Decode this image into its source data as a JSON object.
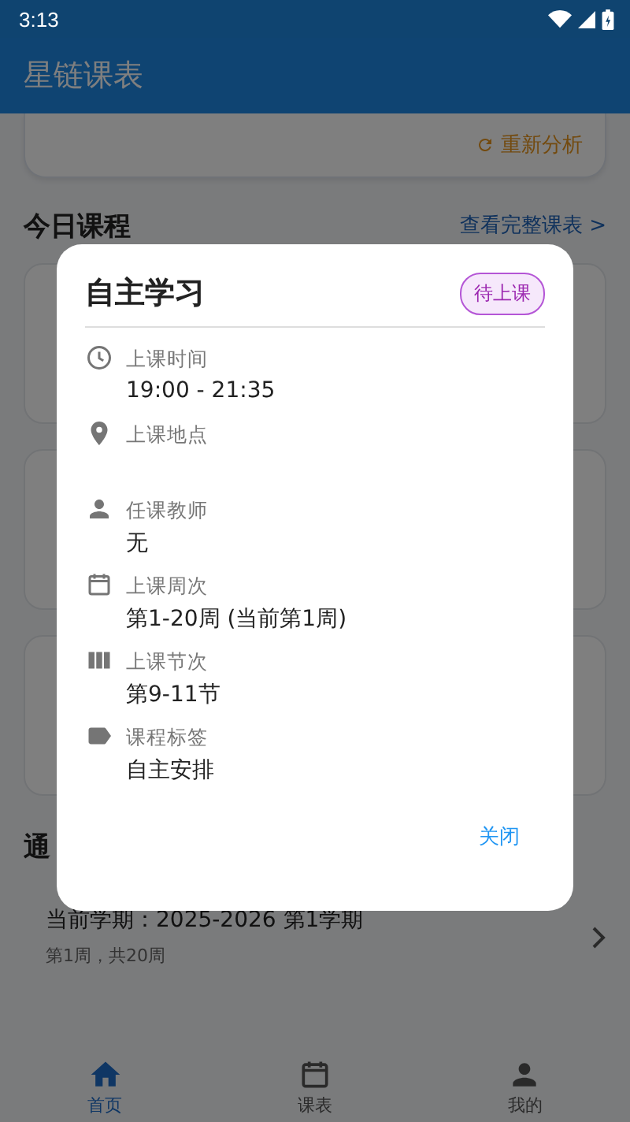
{
  "status_bar": {
    "time": "3:13"
  },
  "app_bar": {
    "title": "星链课表"
  },
  "analysis_card": {
    "action": "重新分析"
  },
  "today_section": {
    "title": "今日课程",
    "link": "查看完整课表 >"
  },
  "notice_section": {
    "title": "通"
  },
  "semester": {
    "title": "当前学期：2025-2026 第1学期",
    "subtitle": "第1周，共20周"
  },
  "nav": [
    {
      "label": "首页",
      "kind": "home",
      "selected": true
    },
    {
      "label": "课表",
      "kind": "calendar",
      "selected": false
    },
    {
      "label": "我的",
      "kind": "person",
      "selected": false
    }
  ],
  "dialog": {
    "title": "自主学习",
    "status": "待上课",
    "fields": [
      {
        "kind": "time",
        "label": "上课时间",
        "value": "19:00 - 21:35"
      },
      {
        "kind": "location",
        "label": "上课地点"
      },
      {
        "kind": "teacher",
        "label": "任课教师",
        "value": "无"
      },
      {
        "kind": "weeks",
        "label": "上课周次",
        "value": "第1-20周 (当前第1周)"
      },
      {
        "kind": "periods",
        "label": "上课节次",
        "value": "第9-11节"
      },
      {
        "kind": "tag",
        "label": "课程标签",
        "value": "自主安排"
      }
    ],
    "close": "关闭"
  }
}
